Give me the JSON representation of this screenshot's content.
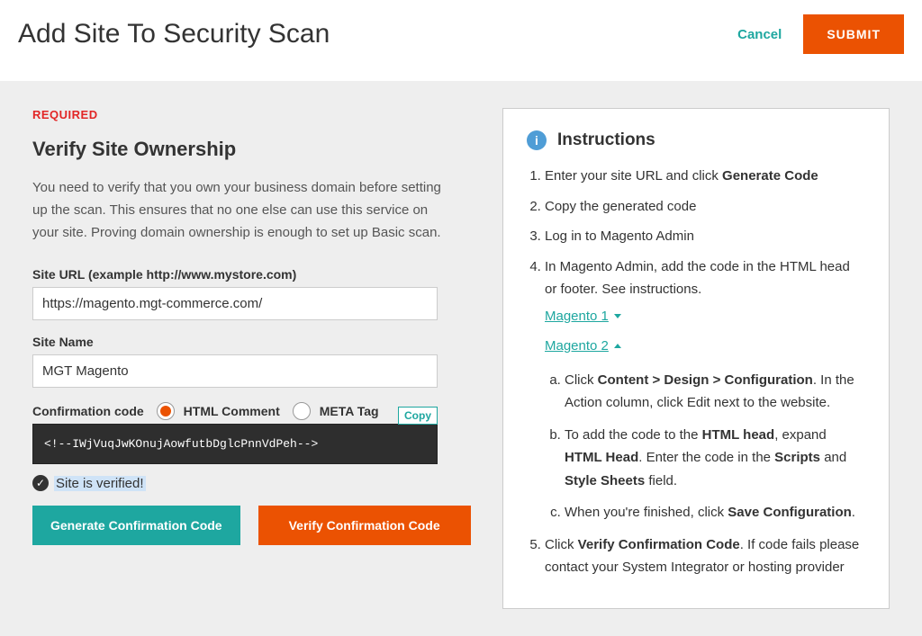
{
  "header": {
    "title": "Add Site To Security Scan",
    "cancel": "Cancel",
    "submit": "SUBMIT"
  },
  "left": {
    "required": "REQUIRED",
    "section_title": "Verify Site Ownership",
    "intro": "You need to verify that you own your business domain before setting up the scan. This ensures that no one else can use this service on your site. Proving domain ownership is enough to set up Basic scan.",
    "site_url_label": "Site URL (example http://www.mystore.com)",
    "site_url_value": "https://magento.mgt-commerce.com/",
    "site_name_label": "Site Name",
    "site_name_value": "MGT Magento",
    "conf_code_label": "Confirmation code",
    "opt_html": "HTML Comment",
    "opt_meta": "META Tag",
    "copy": "Copy",
    "code": "<!--IWjVuqJwKOnujAowfutbDglcPnnVdPeh-->",
    "verified": "Site is verified!",
    "gen_btn": "Generate Confirmation Code",
    "verify_btn": "Verify Confirmation Code"
  },
  "right": {
    "title": "Instructions",
    "s1a": "Enter your site URL and click ",
    "s1b": "Generate Code",
    "s2": "Copy the generated code",
    "s3": "Log in to Magento Admin",
    "s4": "In Magento Admin, add the code in the HTML head or footer. See instructions.",
    "mag1": "Magento 1",
    "mag2": "Magento 2",
    "sa1": "Click ",
    "sa2": "Content > Design > Configuration",
    "sa3": ". In the Action column, click Edit next to the website.",
    "sb1": "To add the code to the ",
    "sb2": "HTML head",
    "sb3": ", expand ",
    "sb4": "HTML Head",
    "sb5": ". Enter the code in the ",
    "sb6": "Scripts",
    "sb7": " and ",
    "sb8": "Style Sheets",
    "sb9": " field.",
    "sc1": "When you're finished, click ",
    "sc2": "Save Configuration",
    "sc3": ".",
    "s5a": "Click ",
    "s5b": "Verify Confirmation Code",
    "s5c": ". If code fails please contact your System Integrator or hosting provider"
  }
}
